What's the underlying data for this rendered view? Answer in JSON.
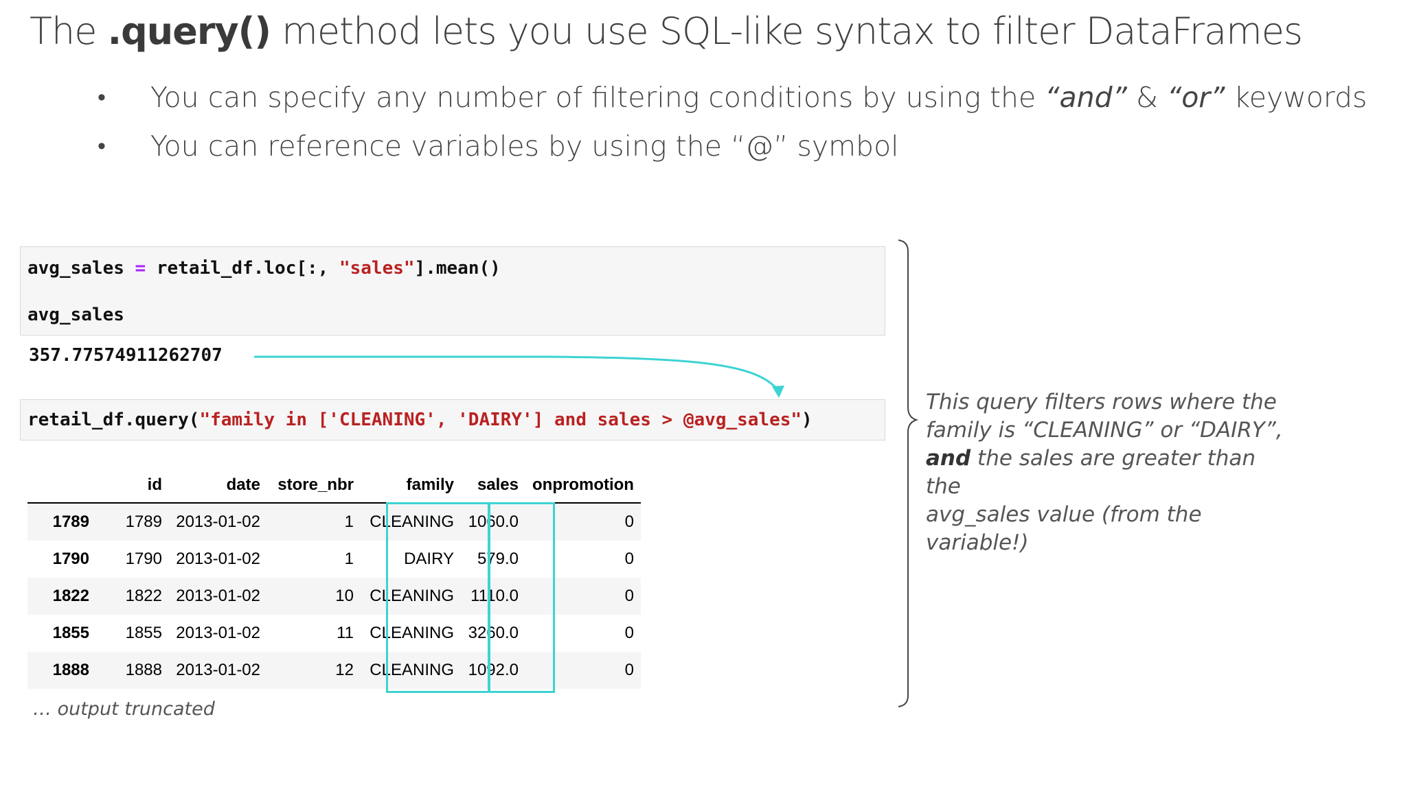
{
  "slide": {
    "title_prefix": "The ",
    "title_bold": ".query()",
    "title_suffix": " method lets you use SQL-like syntax to filter DataFrames",
    "bullets": [
      {
        "before": "You can specify any number of filtering conditions by using the ",
        "italic1": "“and”",
        "middle": " & ",
        "italic2": "“or”",
        "after": " keywords"
      },
      {
        "text": "You can reference variables by using the “@” symbol"
      }
    ],
    "bullet_glyph": "•"
  },
  "code": {
    "cell1": {
      "line1_a": "avg_sales ",
      "line1_op": "=",
      "line1_b": " retail_df.loc[:, ",
      "line1_str": "\"sales\"",
      "line1_c": "].mean()",
      "line2": "avg_sales"
    },
    "output": "357.77574911262707",
    "cell2": {
      "a": "retail_df.query(",
      "str": "\"family in ['CLEANING', 'DAIRY'] and sales > @avg_sales\"",
      "b": ")"
    }
  },
  "table": {
    "columns": [
      "",
      "id",
      "date",
      "store_nbr",
      "family",
      "sales",
      "onpromotion"
    ],
    "rows": [
      {
        "index": "1789",
        "id": "1789",
        "date": "2013-01-02",
        "store_nbr": "1",
        "family": "CLEANING",
        "sales": "1060.0",
        "onpromotion": "0"
      },
      {
        "index": "1790",
        "id": "1790",
        "date": "2013-01-02",
        "store_nbr": "1",
        "family": "DAIRY",
        "sales": "579.0",
        "onpromotion": "0"
      },
      {
        "index": "1822",
        "id": "1822",
        "date": "2013-01-02",
        "store_nbr": "10",
        "family": "CLEANING",
        "sales": "1110.0",
        "onpromotion": "0"
      },
      {
        "index": "1855",
        "id": "1855",
        "date": "2013-01-02",
        "store_nbr": "11",
        "family": "CLEANING",
        "sales": "3260.0",
        "onpromotion": "0"
      },
      {
        "index": "1888",
        "id": "1888",
        "date": "2013-01-02",
        "store_nbr": "12",
        "family": "CLEANING",
        "sales": "1092.0",
        "onpromotion": "0"
      }
    ],
    "truncated_note": "… output truncated"
  },
  "note": {
    "line1": "This query filters rows where the",
    "line2": "family is “CLEANING” or “DAIRY”,",
    "line3_bold": "and",
    "line3_rest": " the sales are greater than the",
    "line4": "avg_sales value (from the variable!)"
  },
  "colors": {
    "highlight": "#3dd3d3",
    "operator": "#aa22ff",
    "string": "#ba2121"
  }
}
